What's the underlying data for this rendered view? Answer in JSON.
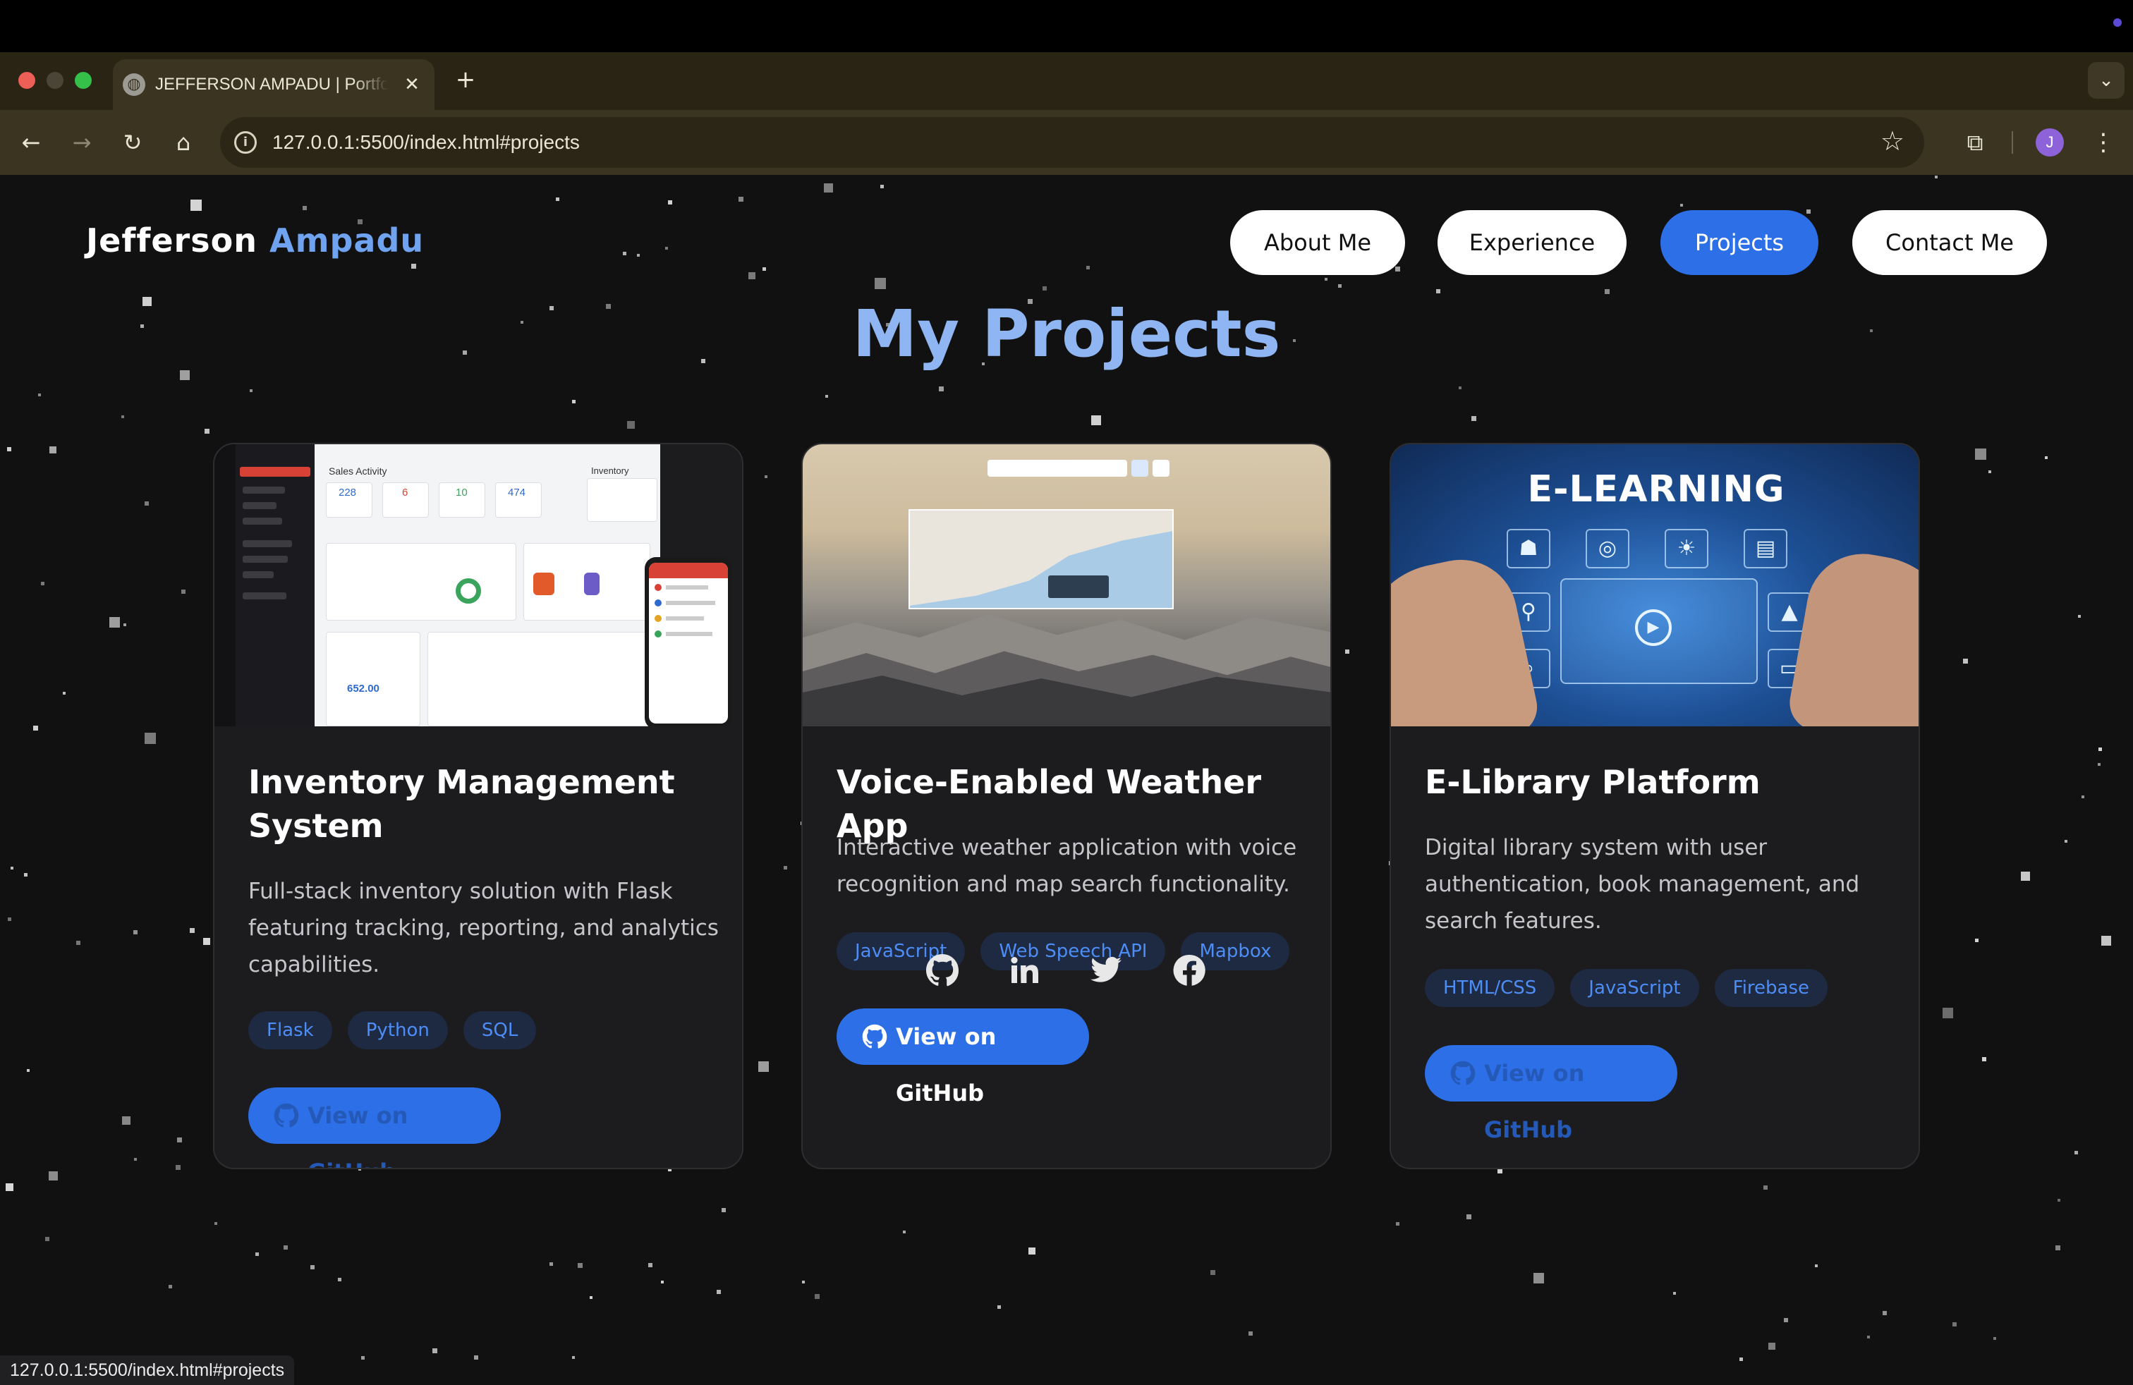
{
  "browser": {
    "tab_title": "JEFFERSON AMPADU | Portfolio",
    "tab_close": "✕",
    "new_tab": "+",
    "url": "127.0.0.1:5500/index.html#projects",
    "profile_initial": "J",
    "status_url": "127.0.0.1:5500/index.html#projects"
  },
  "site": {
    "brand_first": "Jefferson",
    "brand_last": "Ampadu",
    "brand_accent_color": "#6fa3ef"
  },
  "nav": {
    "about": "About Me",
    "experience": "Experience",
    "projects": "Projects",
    "contact": "Contact Me",
    "active": "Projects"
  },
  "section_title": "My Projects",
  "projects": [
    {
      "title": "Inventory Management System",
      "description": "Full-stack inventory solution with Flask featuring tracking, reporting, and analytics capabilities.",
      "tags": [
        "Flask",
        "Python",
        "SQL"
      ],
      "button": "View on GitHub"
    },
    {
      "title": "Voice-Enabled Weather App",
      "description": "Interactive weather application with voice recognition and map search functionality.",
      "tags": [
        "JavaScript",
        "Web Speech API",
        "Mapbox"
      ],
      "button": "View on GitHub"
    },
    {
      "title": "E-Library Platform",
      "description": "Digital library system with user authentication, book management, and search features.",
      "tags": [
        "HTML/CSS",
        "JavaScript",
        "Firebase"
      ],
      "button": "View on GitHub"
    }
  ],
  "thumbnails": {
    "inventory": {
      "sidebar_header": "Inventory",
      "activity_title": "Sales Activity",
      "summary_title": "Inventory Summary",
      "stats": [
        "228",
        "6",
        "10",
        "474"
      ],
      "total": "652.00"
    },
    "elibrary": {
      "banner": "E-LEARNING"
    }
  },
  "social": [
    "github-icon",
    "linkedin-icon",
    "twitter-icon",
    "facebook-icon"
  ],
  "colors": {
    "accent": "#2d6fe6",
    "title": "#8fb6f3",
    "tag_text": "#4d8df5",
    "card_bg": "#1c1c1e"
  }
}
